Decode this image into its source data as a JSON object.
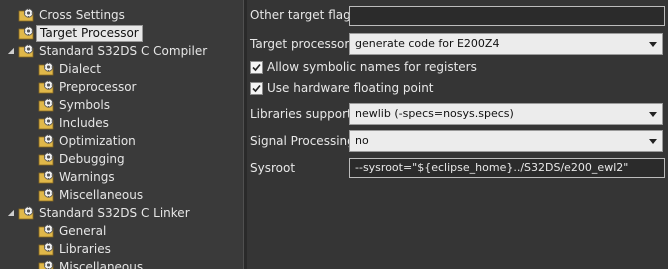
{
  "tree": {
    "items": [
      {
        "label": "Cross Settings",
        "icon": "settings-gear-icon",
        "level": 1,
        "expander": "",
        "selected": false
      },
      {
        "label": "Target Processor",
        "icon": "settings-gear-icon",
        "level": 1,
        "expander": "",
        "selected": true
      },
      {
        "label": "Standard S32DS C Compiler",
        "icon": "settings-gear-icon",
        "level": 0,
        "expander": "expanded",
        "selected": false
      },
      {
        "label": "Dialect",
        "icon": "settings-gear-icon",
        "level": 2,
        "expander": "",
        "selected": false
      },
      {
        "label": "Preprocessor",
        "icon": "settings-gear-icon",
        "level": 2,
        "expander": "",
        "selected": false
      },
      {
        "label": "Symbols",
        "icon": "settings-gear-icon",
        "level": 2,
        "expander": "",
        "selected": false
      },
      {
        "label": "Includes",
        "icon": "settings-gear-icon",
        "level": 2,
        "expander": "",
        "selected": false
      },
      {
        "label": "Optimization",
        "icon": "settings-gear-icon",
        "level": 2,
        "expander": "",
        "selected": false
      },
      {
        "label": "Debugging",
        "icon": "settings-gear-icon",
        "level": 2,
        "expander": "",
        "selected": false
      },
      {
        "label": "Warnings",
        "icon": "settings-gear-icon",
        "level": 2,
        "expander": "",
        "selected": false
      },
      {
        "label": "Miscellaneous",
        "icon": "settings-gear-icon",
        "level": 2,
        "expander": "",
        "selected": false
      },
      {
        "label": "Standard S32DS C Linker",
        "icon": "settings-gear-icon",
        "level": 0,
        "expander": "expanded",
        "selected": false
      },
      {
        "label": "General",
        "icon": "settings-gear-icon",
        "level": 2,
        "expander": "",
        "selected": false
      },
      {
        "label": "Libraries",
        "icon": "settings-gear-icon",
        "level": 2,
        "expander": "",
        "selected": false
      },
      {
        "label": "Miscellaneous",
        "icon": "settings-gear-icon",
        "level": 2,
        "expander": "",
        "selected": false
      }
    ]
  },
  "form": {
    "other_flags": {
      "label": "Other target flags",
      "value": ""
    },
    "target_processor": {
      "label": "Target processor",
      "value": "generate code for E200Z4"
    },
    "allow_symbolic": {
      "label": "Allow symbolic names for registers",
      "checked": true
    },
    "use_hw_fp": {
      "label": "Use hardware floating point",
      "checked": true
    },
    "libraries_support": {
      "label": "Libraries support",
      "value": "newlib (-specs=nosys.specs)"
    },
    "signal_processing": {
      "label": "Signal Processing",
      "value": "no"
    },
    "sysroot": {
      "label": "Sysroot",
      "value": "--sysroot=\"${eclipse_home}../S32DS/e200_ewl2\""
    }
  },
  "colors": {
    "panel_bg": "#353535",
    "tree_bg": "#3a3a3a",
    "text": "#e8e8e8",
    "selection_bg": "#e8e8e8"
  }
}
